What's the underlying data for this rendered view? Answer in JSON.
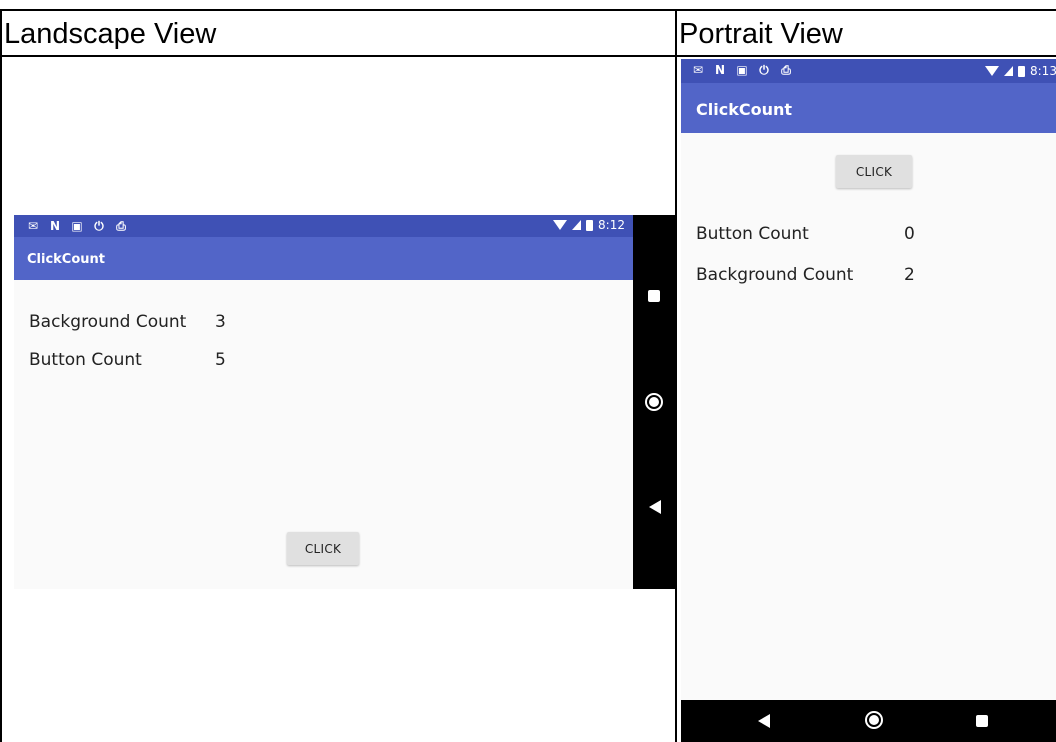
{
  "headers": {
    "landscape": "Landscape View",
    "portrait": "Portrait View"
  },
  "landscape": {
    "status_time": "8:12",
    "status_icons": [
      "gmail-icon",
      "n-icon",
      "sim-icon",
      "power-icon",
      "clipboard-icon"
    ],
    "app_title": "ClickCount",
    "rows": [
      {
        "label": "Background Count",
        "value": "3"
      },
      {
        "label": "Button Count",
        "value": "5"
      }
    ],
    "button_label": "CLICK"
  },
  "portrait": {
    "status_time": "8:13",
    "status_icons": [
      "gmail-icon",
      "n-icon",
      "sim-icon",
      "power-icon",
      "clipboard-icon"
    ],
    "app_title": "ClickCount",
    "button_label": "CLICK",
    "rows": [
      {
        "label": "Button Count",
        "value": "0"
      },
      {
        "label": "Background Count",
        "value": "2"
      }
    ]
  },
  "colors": {
    "status_bar": "#3f51b5",
    "app_bar": "#5265c8",
    "screen_bg": "#fafafa",
    "nav_bar": "#000000",
    "button_bg": "#e0e0e0"
  }
}
